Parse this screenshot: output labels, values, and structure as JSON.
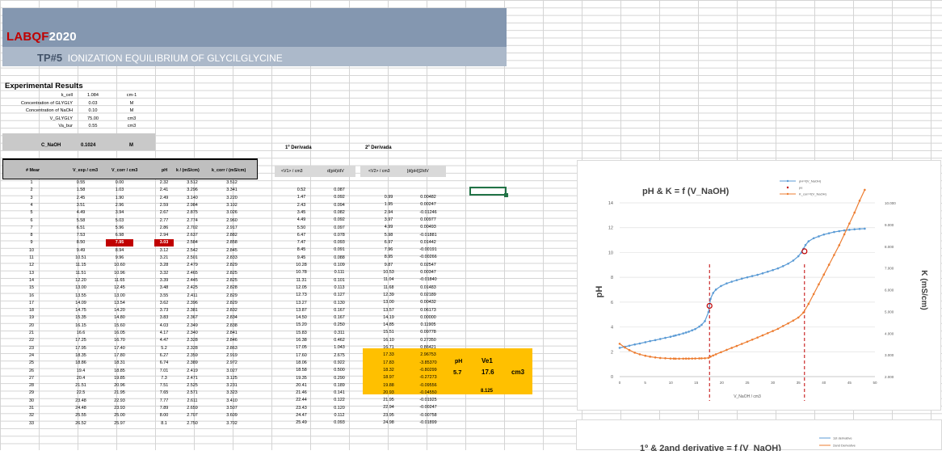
{
  "brand": {
    "red": "LABQF",
    "white": "2020"
  },
  "subtitle": {
    "tp": "TP#5",
    "text": "IONIZATION EQUILIBRIUM OF GLYCILGLYCINE"
  },
  "experimental": {
    "title": "Experimental Results",
    "params": [
      {
        "label": "k_cell",
        "value": "1.084",
        "unit": "cm-1"
      },
      {
        "label": "Concentration of GLYGLY",
        "value": "0.03",
        "unit": "M"
      },
      {
        "label": "Concentration of NaOH",
        "value": "0.10",
        "unit": "M"
      },
      {
        "label": "V_GLYGLY",
        "value": "75.00",
        "unit": "cm3"
      },
      {
        "label": "Va_bur",
        "value": "0.55",
        "unit": "cm3"
      }
    ],
    "cnaoh": {
      "label": "C_NaOH",
      "value": "0.1024",
      "unit": "M"
    }
  },
  "deriv_labels": {
    "first": "1º Derivada",
    "second": "2º Derivada"
  },
  "table": {
    "headers": [
      "# Mear",
      "V_exp / cm3",
      "V_corr / cm3",
      "pH",
      "k / (mS/cm)",
      "k_corr / (mS/cm)"
    ],
    "rows": [
      [
        "1",
        "0.55",
        "0.00",
        "2.32",
        "3.512",
        "3.512"
      ],
      [
        "2",
        "1.58",
        "1.03",
        "2.41",
        "3.296",
        "3.341"
      ],
      [
        "3",
        "2.45",
        "1.90",
        "2.49",
        "3.140",
        "3.220"
      ],
      [
        "4",
        "3.51",
        "2.96",
        "2.59",
        "2.984",
        "3.102"
      ],
      [
        "5",
        "4.49",
        "3.94",
        "2.67",
        "2.875",
        "3.026"
      ],
      [
        "6",
        "5.58",
        "5.03",
        "2.77",
        "2.774",
        "2.960"
      ],
      [
        "7",
        "6.51",
        "5.96",
        "2.86",
        "2.702",
        "2.917"
      ],
      [
        "8",
        "7.53",
        "6.98",
        "2.94",
        "2.637",
        "2.882"
      ],
      [
        "9",
        "8.50",
        "7.95",
        "3.03",
        "2.584",
        "2.858"
      ],
      [
        "10",
        "9.49",
        "8.94",
        "3.12",
        "2.542",
        "2.845"
      ],
      [
        "11",
        "10.51",
        "9.96",
        "3.21",
        "2.501",
        "2.833"
      ],
      [
        "12",
        "11.15",
        "10.60",
        "3.28",
        "2.479",
        "2.829"
      ],
      [
        "13",
        "11.51",
        "10.96",
        "3.32",
        "2.465",
        "2.825"
      ],
      [
        "14",
        "12.20",
        "11.65",
        "3.39",
        "2.445",
        "2.825"
      ],
      [
        "15",
        "13.00",
        "12.45",
        "3.48",
        "2.425",
        "2.828"
      ],
      [
        "16",
        "13.55",
        "13.00",
        "3.55",
        "2.411",
        "2.829"
      ],
      [
        "17",
        "14.09",
        "13.54",
        "3.62",
        "2.396",
        "2.829"
      ],
      [
        "18",
        "14.75",
        "14.20",
        "3.73",
        "2.381",
        "2.832"
      ],
      [
        "19",
        "15.35",
        "14.80",
        "3.83",
        "2.367",
        "2.834"
      ],
      [
        "20",
        "16.15",
        "15.60",
        "4.03",
        "2.349",
        "2.838"
      ],
      [
        "21",
        "16.6",
        "16.05",
        "4.17",
        "2.340",
        "2.841"
      ],
      [
        "22",
        "17.25",
        "16.70",
        "4.47",
        "2.328",
        "2.846"
      ],
      [
        "23",
        "17.95",
        "17.40",
        "5.2",
        "2.328",
        "2.863"
      ],
      [
        "24",
        "18.35",
        "17.80",
        "6.27",
        "2.359",
        "2.919"
      ],
      [
        "25",
        "18.86",
        "18.31",
        "6.74",
        "2.389",
        "2.972"
      ],
      [
        "26",
        "19.4",
        "18.85",
        "7.01",
        "2.419",
        "3.027"
      ],
      [
        "27",
        "20.4",
        "19.85",
        "7.3",
        "2.471",
        "3.125"
      ],
      [
        "28",
        "21.51",
        "20.96",
        "7.51",
        "2.525",
        "3.231"
      ],
      [
        "29",
        "22.5",
        "21.95",
        "7.65",
        "2.571",
        "3.323"
      ],
      [
        "30",
        "23.48",
        "22.93",
        "7.77",
        "2.611",
        "3.410"
      ],
      [
        "31",
        "24.48",
        "23.93",
        "7.89",
        "2.659",
        "3.507"
      ],
      [
        "32",
        "25.55",
        "25.00",
        "8.00",
        "2.707",
        "3.609"
      ],
      [
        "33",
        "26.52",
        "25.97",
        "8.1",
        "2.750",
        "3.702"
      ]
    ]
  },
  "deriv1": {
    "headers": [
      "<V1> / cm3",
      "d(pH)/dV"
    ],
    "rows": [
      [
        "0.52",
        "0.087"
      ],
      [
        "1.47",
        "0.092"
      ],
      [
        "2.43",
        "0.094"
      ],
      [
        "3.45",
        "0.082"
      ],
      [
        "4.49",
        "0.092"
      ],
      [
        "5.50",
        "0.097"
      ],
      [
        "6.47",
        "0.078"
      ],
      [
        "7.47",
        "0.093"
      ],
      [
        "8.45",
        "0.091"
      ],
      [
        "9.45",
        "0.088"
      ],
      [
        "10.28",
        "0.109"
      ],
      [
        "10.78",
        "0.111"
      ],
      [
        "11.31",
        "0.101"
      ],
      [
        "12.05",
        "0.113"
      ],
      [
        "12.73",
        "0.127"
      ],
      [
        "13.27",
        "0.130"
      ],
      [
        "13.87",
        "0.167"
      ],
      [
        "14.50",
        "0.167"
      ],
      [
        "15.20",
        "0.250"
      ],
      [
        "15.83",
        "0.311"
      ],
      [
        "16.38",
        "0.462"
      ],
      [
        "17.05",
        "1.043"
      ],
      [
        "17.60",
        "2.675"
      ],
      [
        "18.06",
        "0.922"
      ],
      [
        "18.58",
        "0.500"
      ],
      [
        "19.35",
        "0.290"
      ],
      [
        "20.41",
        "0.189"
      ],
      [
        "21.46",
        "0.141"
      ],
      [
        "22.44",
        "0.122"
      ],
      [
        "23.43",
        "0.120"
      ],
      [
        "24.47",
        "0.112"
      ],
      [
        "25.49",
        "0.093"
      ]
    ]
  },
  "deriv2": {
    "headers": [
      "<V2> / cm3",
      "[d(pH)]2/dV"
    ],
    "rows": [
      [
        "0.99",
        "0.00482"
      ],
      [
        "1.95",
        "0.00247"
      ],
      [
        "2.94",
        "-0.01246"
      ],
      [
        "3.97",
        "0.00977"
      ],
      [
        "4.99",
        "0.00493"
      ],
      [
        "5.98",
        "-0.01881"
      ],
      [
        "6.97",
        "0.01442"
      ],
      [
        "7.96",
        "-0.00191"
      ],
      [
        "8.95",
        "-0.00266"
      ],
      [
        "9.87",
        "0.02547"
      ],
      [
        "10.53",
        "0.00347"
      ],
      [
        "11.04",
        "-0.01840"
      ],
      [
        "11.68",
        "0.01483"
      ],
      [
        "12.39",
        "0.02189"
      ],
      [
        "13.00",
        "0.00432"
      ],
      [
        "13.57",
        "0.06173"
      ],
      [
        "14.19",
        "0.00000"
      ],
      [
        "14.85",
        "0.11905"
      ],
      [
        "15.51",
        "0.09778"
      ],
      [
        "16.10",
        "0.27350"
      ],
      [
        "16.71",
        "0.86421"
      ],
      [
        "17.33",
        "2.96753"
      ],
      [
        "17.83",
        "-3.85370"
      ],
      [
        "18.32",
        "-0.80299"
      ],
      [
        "18.97",
        "-0.27273"
      ],
      [
        "19.88",
        "-0.09556"
      ],
      [
        "20.93",
        "-0.04550"
      ],
      [
        "21.95",
        "-0.01925"
      ],
      [
        "22.94",
        "-0.00247"
      ],
      [
        "23.95",
        "-0.00758"
      ],
      [
        "24.98",
        "-0.01899"
      ]
    ]
  },
  "results": {
    "ph_label": "pH",
    "ph_value": "5.7",
    "ve_label": "Ve1",
    "ve_value": "17.6",
    "ve_unit": "cm3",
    "extra": "8.125"
  },
  "chart_data": [
    {
      "type": "scatter",
      "title": "pH & K  = f (V_NaOH)",
      "xlabel": "V_NaOH / cm3",
      "ylabel": "pH",
      "y2label": "K (mS/cm)",
      "xlim": [
        0,
        50
      ],
      "ylim": [
        0,
        14
      ],
      "y2lim": [
        2.0,
        10.0
      ],
      "xticks": [
        "0",
        "5",
        "10",
        "15",
        "20",
        "25",
        "30",
        "35",
        "40",
        "45",
        "50"
      ],
      "yticks": [
        "0",
        "2",
        "4",
        "6",
        "8",
        "10",
        "12",
        "14"
      ],
      "y2ticks": [
        "2.000",
        "3.000",
        "4.000",
        "5.000",
        "6.000",
        "7.000",
        "8.000",
        "9.000",
        "10.000"
      ],
      "legend": [
        "pH=f(V_NaOH)",
        "pe",
        "K_corr=f(V_NaOH)"
      ],
      "legend_position": "top-right",
      "colors": {
        "ph": "#5b9bd5",
        "k": "#ed7d31",
        "pe": "#c00000",
        "vline": "#c00000"
      },
      "equivalence_points": [
        {
          "x": 17.6,
          "y": 5.7
        },
        {
          "x": 36.2,
          "y": 10.1
        }
      ],
      "vlines": [
        17.6,
        36.2
      ],
      "series": [
        {
          "name": "pH=f(V_NaOH)",
          "axis": "left",
          "x": [
            0,
            1.03,
            1.9,
            2.96,
            3.94,
            5.03,
            5.96,
            6.98,
            7.95,
            8.94,
            9.96,
            10.6,
            10.96,
            11.65,
            12.45,
            13.0,
            13.54,
            14.2,
            14.8,
            15.6,
            16.05,
            16.7,
            17.4,
            17.8,
            18.31,
            18.85,
            19.85,
            20.96,
            21.95,
            22.93,
            23.93,
            25.0,
            25.97,
            27.0,
            28.0,
            29.0,
            30.0,
            31.0,
            32.0,
            33.0,
            34.0,
            35.0,
            35.6,
            36.0,
            36.4,
            37.0,
            38.0,
            39.0,
            40.0,
            41.0,
            42.0,
            43.0,
            44.0,
            45.0,
            46.0,
            47.0,
            48.0
          ],
          "y": [
            2.32,
            2.41,
            2.49,
            2.59,
            2.67,
            2.77,
            2.86,
            2.94,
            3.03,
            3.12,
            3.21,
            3.28,
            3.32,
            3.39,
            3.48,
            3.55,
            3.62,
            3.73,
            3.83,
            4.03,
            4.17,
            4.47,
            5.2,
            6.27,
            6.74,
            7.01,
            7.3,
            7.51,
            7.65,
            7.77,
            7.89,
            8.0,
            8.1,
            8.2,
            8.32,
            8.45,
            8.58,
            8.72,
            8.9,
            9.1,
            9.35,
            9.7,
            10.0,
            10.3,
            10.6,
            10.9,
            11.15,
            11.3,
            11.45,
            11.55,
            11.65,
            11.72,
            11.78,
            11.83,
            11.87,
            11.9,
            11.92
          ]
        },
        {
          "name": "K_corr=f(V_NaOH)",
          "axis": "right",
          "x": [
            0,
            1.03,
            1.9,
            2.96,
            3.94,
            5.03,
            5.96,
            6.98,
            7.95,
            8.94,
            9.96,
            10.6,
            10.96,
            11.65,
            12.45,
            13.0,
            13.54,
            14.2,
            14.8,
            15.6,
            16.05,
            16.7,
            17.4,
            17.8,
            18.31,
            18.85,
            19.85,
            20.96,
            21.95,
            22.93,
            23.93,
            25.0,
            25.97,
            27.0,
            28.0,
            29.0,
            30.0,
            31.0,
            32.0,
            33.0,
            34.0,
            35.0,
            36.0,
            37.0,
            38.0,
            39.0,
            40.0,
            41.0,
            42.0,
            43.0,
            44.0,
            45.0,
            46.0,
            47.0,
            48.0
          ],
          "y": [
            3.512,
            3.341,
            3.22,
            3.102,
            3.026,
            2.96,
            2.917,
            2.882,
            2.858,
            2.845,
            2.833,
            2.829,
            2.825,
            2.825,
            2.828,
            2.829,
            2.829,
            2.832,
            2.834,
            2.838,
            2.841,
            2.846,
            2.863,
            2.919,
            2.972,
            3.027,
            3.125,
            3.231,
            3.323,
            3.41,
            3.507,
            3.609,
            3.702,
            3.8,
            3.9,
            4.0,
            4.1,
            4.2,
            4.33,
            4.45,
            4.58,
            4.72,
            4.95,
            5.35,
            5.8,
            6.25,
            6.7,
            7.15,
            7.6,
            8.05,
            8.55,
            9.05,
            9.55,
            10.1,
            10.6
          ]
        }
      ]
    },
    {
      "type": "line",
      "title": "1º & 2and derivative  = f (V_NaOH)",
      "legend": [
        "1st derivative",
        "2and Derivative"
      ],
      "legend_position": "top-right",
      "colors": {
        "d1": "#5b9bd5",
        "d2": "#ed7d31"
      },
      "series": [
        {
          "name": "1st derivative"
        },
        {
          "name": "2and Derivative"
        }
      ]
    }
  ]
}
